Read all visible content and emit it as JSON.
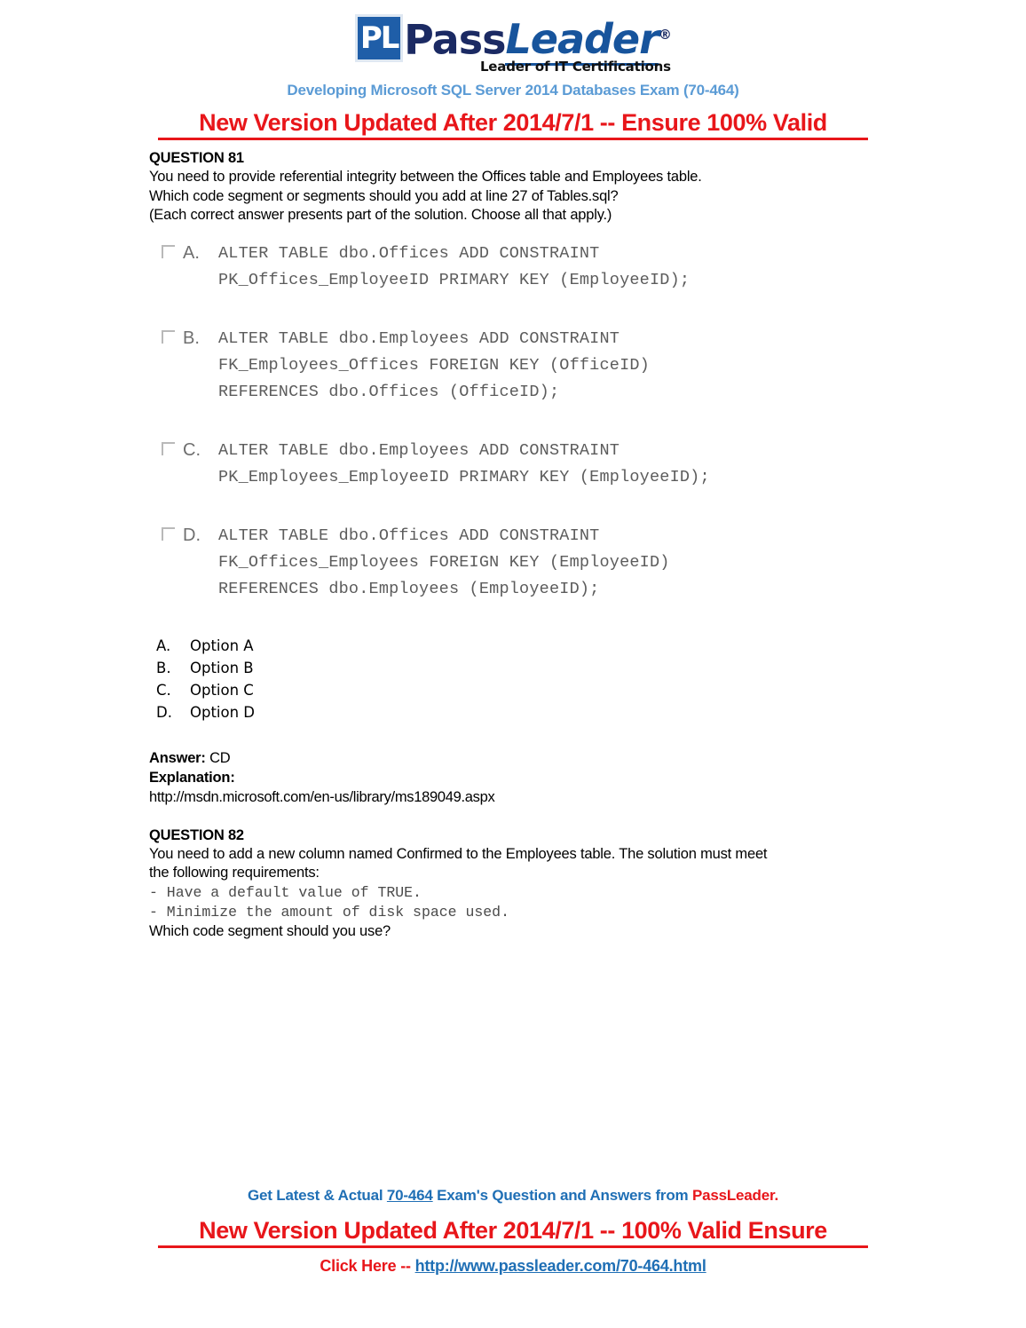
{
  "logo": {
    "badge_text": "PL",
    "word_pass": "Pass",
    "word_leader": "Leader",
    "registered_mark": "®",
    "tagline": "Leader of IT Certifications"
  },
  "header": {
    "exam_subtitle": "Developing Microsoft SQL Server 2014 Databases Exam (70-464)",
    "banner": "New Version Updated After 2014/7/1 -- Ensure 100% Valid"
  },
  "question81": {
    "title": "QUESTION 81",
    "lines": [
      "You need to provide referential integrity between the Offices table and Employees table.",
      "Which code segment or segments should you add at line 27 of Tables.sql?",
      "(Each correct answer presents part of the solution. Choose all that apply.)"
    ],
    "code_options": [
      {
        "letter": "A.",
        "code": "ALTER TABLE dbo.Offices ADD CONSTRAINT\nPK_Offices_EmployeeID PRIMARY KEY (EmployeeID);"
      },
      {
        "letter": "B.",
        "code": "ALTER TABLE dbo.Employees ADD CONSTRAINT\nFK_Employees_Offices FOREIGN KEY (OfficeID)\nREFERENCES dbo.Offices (OfficeID);"
      },
      {
        "letter": "C.",
        "code": "ALTER TABLE dbo.Employees ADD CONSTRAINT\nPK_Employees_EmployeeID PRIMARY KEY (EmployeeID);"
      },
      {
        "letter": "D.",
        "code": "ALTER TABLE dbo.Offices ADD CONSTRAINT\nFK_Offices_Employees FOREIGN KEY (EmployeeID)\nREFERENCES dbo.Employees (EmployeeID);"
      }
    ],
    "options": [
      {
        "label": "A.",
        "text": "Option A"
      },
      {
        "label": "B.",
        "text": "Option B"
      },
      {
        "label": "C.",
        "text": "Option C"
      },
      {
        "label": "D.",
        "text": "Option D"
      }
    ],
    "answer_label": "Answer:",
    "answer_value": "CD",
    "explanation_label": "Explanation:",
    "explanation_url": "http://msdn.microsoft.com/en-us/library/ms189049.aspx"
  },
  "question82": {
    "title": "QUESTION 82",
    "line1": "You need to add a new column named Confirmed to the Employees table. The solution must meet",
    "line2": "the following requirements:",
    "requirements": [
      "- Have a default value of TRUE.",
      "- Minimize the amount of disk space used."
    ],
    "line3": "Which code segment should you use?"
  },
  "footer": {
    "line1_part1": "Get Latest & Actual ",
    "line1_exam": "70-464",
    "line1_part2": " Exam's Question and Answers from ",
    "line1_brand": "PassLeader.",
    "banner": "New Version Updated After 2014/7/1 -- 100% Valid Ensure",
    "click_here": "Click Here -- ",
    "url": "http://www.passleader.com/70-464.html"
  },
  "colors": {
    "brand_blue": "#1f5ea8",
    "subtitle_blue": "#5b9bd5",
    "link_blue": "#1f6fb5",
    "banner_red": "#e8161a"
  }
}
